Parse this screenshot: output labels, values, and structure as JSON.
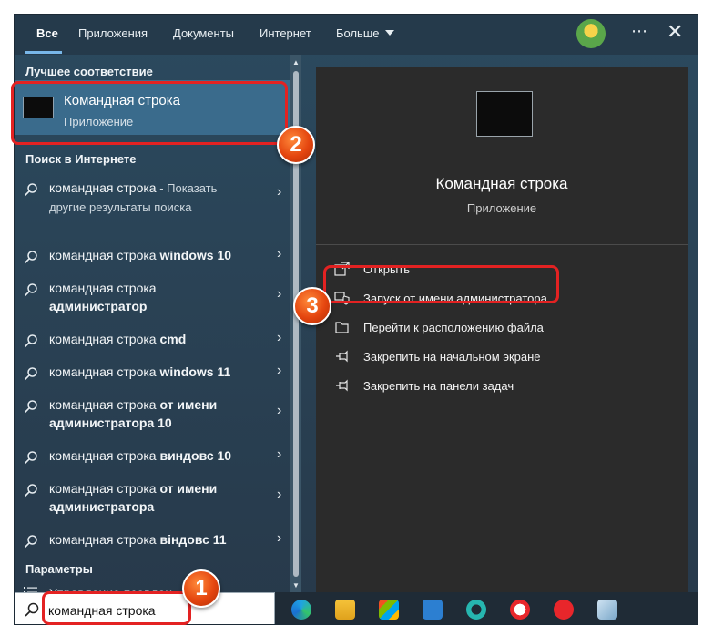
{
  "tabs": [
    {
      "label": "Все",
      "active": true
    },
    {
      "label": "Приложения"
    },
    {
      "label": "Документы"
    },
    {
      "label": "Интернет"
    },
    {
      "label": "Больше"
    }
  ],
  "icons": {
    "more": "⋯",
    "close": "✕",
    "chevron": "›"
  },
  "best_match": {
    "heading": "Лучшее соответствие",
    "title": "Командная строка",
    "subtitle": "Приложение"
  },
  "web_search": {
    "heading": "Поиск в Интернете",
    "items": [
      {
        "plain": "командная строка",
        "bold": "",
        "suffix": " - Показать",
        "sub": "другие результаты поиска"
      },
      {
        "plain": "командная строка ",
        "bold": "windows 10"
      },
      {
        "plain": "командная строка ",
        "bold": "администратор"
      },
      {
        "plain": "командная строка ",
        "bold": "cmd"
      },
      {
        "plain": "командная строка ",
        "bold": "windows 11"
      },
      {
        "plain": "командная строка ",
        "bold": "от имени администратора 10"
      },
      {
        "plain": "командная строка ",
        "bold": "виндовс 10"
      },
      {
        "plain": "командная строка ",
        "bold": "от имени администратора"
      },
      {
        "plain": "командная строка ",
        "bold": "віндовс 11"
      }
    ]
  },
  "settings": {
    "heading": "Параметры",
    "item": "Управление псевдон"
  },
  "preview": {
    "title": "Командная строка",
    "subtitle": "Приложение",
    "actions": [
      {
        "label": "Открыть",
        "icon": "open-icon"
      },
      {
        "label": "Запуск от имени администратора",
        "icon": "shield-icon"
      },
      {
        "label": "Перейти к расположению файла",
        "icon": "folder-icon"
      },
      {
        "label": "Закрепить на начальном экране",
        "icon": "pin-icon"
      },
      {
        "label": "Закрепить на панели задач",
        "icon": "pin-icon"
      }
    ]
  },
  "search": {
    "value": "командная строка"
  },
  "annotations": [
    "1",
    "2",
    "3"
  ],
  "colors": {
    "accent": "#78b7e9",
    "highlight": "#e32222",
    "best_match_bg": "#3a6b8c"
  }
}
